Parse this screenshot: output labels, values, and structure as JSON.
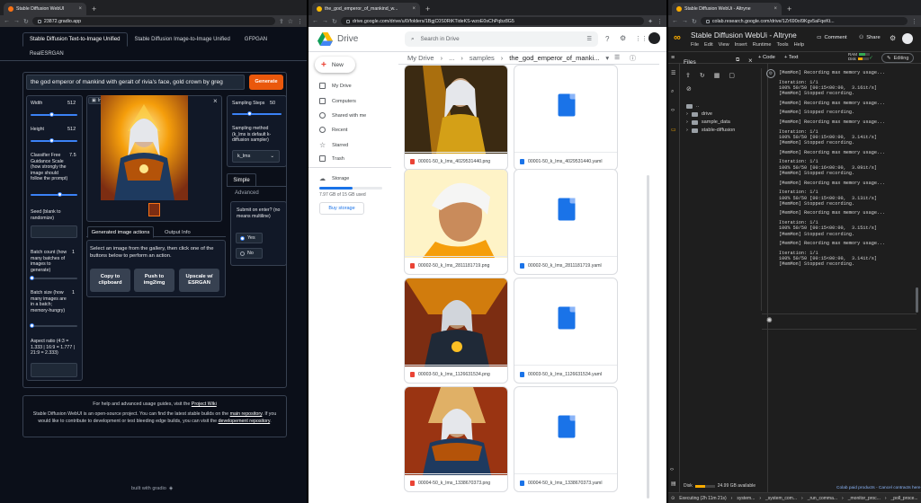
{
  "win1": {
    "tab_title": "Stable Diffusion WebUI",
    "url": "23872.gradio.app",
    "tabs": [
      "Stable Diffusion Text-to-Image Unified",
      "Stable Diffusion Image-to-Image Unified",
      "GFPGAN",
      "RealESRGAN"
    ],
    "prompt": "the god emperor of mankind with geralt of rivia's face, gold crown by greg",
    "generate": "Generate",
    "width_label": "Width",
    "width_val": "512",
    "height_label": "Height",
    "height_val": "512",
    "cfg_label": "Classifier Free Guidance Scale (how strongly the image should follow the prompt)",
    "cfg_val": "7.5",
    "seed_label": "Seed (blank to randomize)",
    "batch_count_label": "Batch count (how many batches of images to generate)",
    "batch_count_val": "1",
    "batch_size_label": "Batch size (how many images are in a batch; memory-hungry)",
    "batch_size_val": "1",
    "aspect_label": "Aspect ratio (4:3 = 1.333 | 16:9 = 1.777 | 21:9 = 2.333)",
    "images_label": "Images",
    "close": "×",
    "steps_label": "Sampling Steps",
    "steps_val": "50",
    "method_label": "Sampling method (k_lms is default k-diffusion sampler)",
    "method_val": "k_lms",
    "simple": "Simple",
    "advanced": "Advanced",
    "submit_label": "Submit on enter? (no means multiline)",
    "yes": "Yes",
    "no": "No",
    "actions_tab": "Generated image actions",
    "output_tab": "Output Info",
    "actions_text": "Select an image from the gallery, then click one of the buttons below to perform an action.",
    "copy_btn": "Copy to clipboard",
    "push_btn": "Push to img2img",
    "upscale_btn": "Upscale w/ ESRGAN",
    "footer1_pre": "For help and advanced usage guides, visit the ",
    "footer1_link": "Project Wiki",
    "footer2_pre": "Stable Diffusion WebUI is an open-source project. You can find the latest stable builds on the ",
    "footer2_link": "main repository",
    "footer2_mid": ". If you would like to contribute to development or test bleeding edge builds, you can visit the ",
    "footer2_link2": "developement repository",
    "built": "built with gradio"
  },
  "win2": {
    "tab_title": "the_god_emperor_of_mankind_w...",
    "url": "drive.google.com/drive/u/0/folders/1BgjC0S0RtKTideKS-wzoE0sChPqbz8G5",
    "app": "Drive",
    "search": "Search in Drive",
    "new": "New",
    "nav": [
      "My Drive",
      "Computers",
      "Shared with me",
      "Recent",
      "Starred",
      "Trash"
    ],
    "storage": "Storage",
    "storage_used": "7.97 GB of 15 GB used",
    "buy": "Buy storage",
    "crumbs": [
      "My Drive",
      "...",
      "samples",
      "the_god_emperor_of_manki..."
    ],
    "files": [
      {
        "img": "00001-50_k_lms_4029531440.png",
        "yaml": "00001-50_k_lms_4029531440.yaml"
      },
      {
        "img": "00002-50_k_lms_2811181719.png",
        "yaml": "00002-50_k_lms_2811181719.yaml"
      },
      {
        "img": "00003-50_k_lms_1126631534.png",
        "yaml": "00003-50_k_lms_1126631534.yaml"
      },
      {
        "img": "00004-50_k_lms_1338670373.png",
        "yaml": "00004-50_k_lms_1338670373.yaml"
      }
    ]
  },
  "win3": {
    "tab_title": "Stable Diffusion WebUi - Altryne",
    "url": "colab.research.google.com/drive/1Zr690oI9Kgv5aFqeKt...",
    "title": "Stable Diffusion WebUi - Altryne",
    "menu": [
      "File",
      "Edit",
      "View",
      "Insert",
      "Runtime",
      "Tools",
      "Help"
    ],
    "comment": "Comment",
    "share": "Share",
    "code": "+ Code",
    "text": "+ Text",
    "ram": "RAM",
    "disk": "Disk",
    "editing": "Editing",
    "files_title": "Files",
    "tree": [
      "..",
      "drive",
      "sample_data",
      "stable-diffusion"
    ],
    "disk_status": "Disk",
    "disk_avail": "24.99 GB available",
    "bottom_link": "Colab paid products - Cancel contracts here",
    "status": "Executing (2h 11m 21s)",
    "status_items": [
      "system...",
      "_system_com...",
      "_run_comma...",
      "_monitor_proc...",
      "_poll_proce..."
    ],
    "output": [
      "[MemMon] Recording max memory usage...",
      "",
      "Iteration: 1/1",
      "100% 50/50 [00:15<00:00,  3.16it/s]",
      "[MemMon] Stopped recording.",
      "",
      "[MemMon] Recording max memory usage...",
      "",
      "[MemMon] Stopped recording.",
      "",
      "[MemMon] Recording max memory usage...",
      "",
      "Iteration: 1/1",
      "100% 50/50 [00:15<00:00,  3.14it/s]",
      "[MemMon] Stopped recording.",
      "",
      "[MemMon] Recording max memory usage...",
      "",
      "Iteration: 1/1",
      "100% 50/50 [00:16<00:00,  3.09it/s]",
      "[MemMon] Stopped recording.",
      "",
      "[MemMon] Recording max memory usage...",
      "",
      "Iteration: 1/1",
      "100% 50/50 [00:15<00:00,  3.13it/s]",
      "[MemMon] Stopped recording.",
      "",
      "[MemMon] Recording max memory usage...",
      "",
      "Iteration: 1/1",
      "100% 50/50 [00:15<00:00,  3.15it/s]",
      "[MemMon] Stopped recording.",
      "",
      "[MemMon] Recording max memory usage...",
      "",
      "Iteration: 1/1",
      "100% 50/50 [00:15<00:00,  3.14it/s]",
      "[MemMon] Stopped recording."
    ]
  }
}
